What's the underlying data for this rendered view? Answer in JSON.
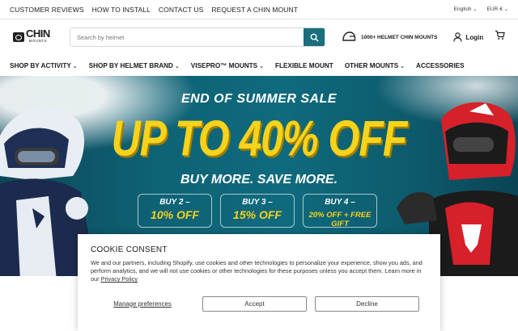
{
  "topbar": {
    "links": [
      "CUSTOMER REVIEWS",
      "HOW TO INSTALL",
      "CONTACT US",
      "REQUEST A CHIN MOUNT"
    ],
    "language": "English",
    "currency": "EUR €"
  },
  "header": {
    "logo_text": "CHIN",
    "logo_sub": "MOUNTS",
    "search_placeholder": "Search by helmet",
    "badge_text": "1000+ HELMET CHIN MOUNTS",
    "login_label": "Login"
  },
  "nav": {
    "items": [
      {
        "label": "SHOP BY ACTIVITY",
        "dropdown": true
      },
      {
        "label": "SHOP BY HELMET BRAND",
        "dropdown": true
      },
      {
        "label": "VISEPRO™ MOUNTS",
        "dropdown": true
      },
      {
        "label": "FLEXIBLE MOUNT",
        "dropdown": false
      },
      {
        "label": "OTHER MOUNTS",
        "dropdown": true
      },
      {
        "label": "ACCESSORIES",
        "dropdown": false
      }
    ]
  },
  "hero": {
    "title": "END OF SUMMER SALE",
    "headline": "UP TO 40% OFF",
    "subline": "BUY MORE. SAVE MORE.",
    "offers": [
      {
        "qty": "BUY 2 –",
        "deal": "10% OFF"
      },
      {
        "qty": "BUY 3 –",
        "deal": "15% OFF"
      },
      {
        "qty": "BUY 4 –",
        "deal": "20% OFF + FREE GIFT"
      }
    ]
  },
  "cookie": {
    "title": "COOKIE CONSENT",
    "body": "We and our partners, including Shopify, use cookies and other technologies to personalize your experience, show you ads, and perform analytics, and we will not use cookies or other technologies for these purposes unless you accept them. Learn more in our ",
    "policy_link": "Privacy Policy",
    "manage_label": "Manage preferences",
    "accept_label": "Accept",
    "decline_label": "Decline"
  },
  "colors": {
    "accent": "#1a6e7e",
    "hero_yellow": "#f7d31c"
  }
}
